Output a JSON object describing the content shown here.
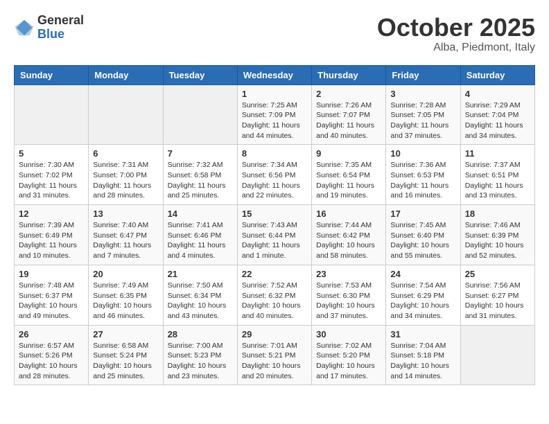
{
  "header": {
    "logo_general": "General",
    "logo_blue": "Blue",
    "month_title": "October 2025",
    "location": "Alba, Piedmont, Italy"
  },
  "days_of_week": [
    "Sunday",
    "Monday",
    "Tuesday",
    "Wednesday",
    "Thursday",
    "Friday",
    "Saturday"
  ],
  "weeks": [
    [
      {
        "day": "",
        "info": ""
      },
      {
        "day": "",
        "info": ""
      },
      {
        "day": "",
        "info": ""
      },
      {
        "day": "1",
        "info": "Sunrise: 7:25 AM\nSunset: 7:09 PM\nDaylight: 11 hours\nand 44 minutes."
      },
      {
        "day": "2",
        "info": "Sunrise: 7:26 AM\nSunset: 7:07 PM\nDaylight: 11 hours\nand 40 minutes."
      },
      {
        "day": "3",
        "info": "Sunrise: 7:28 AM\nSunset: 7:05 PM\nDaylight: 11 hours\nand 37 minutes."
      },
      {
        "day": "4",
        "info": "Sunrise: 7:29 AM\nSunset: 7:04 PM\nDaylight: 11 hours\nand 34 minutes."
      }
    ],
    [
      {
        "day": "5",
        "info": "Sunrise: 7:30 AM\nSunset: 7:02 PM\nDaylight: 11 hours\nand 31 minutes."
      },
      {
        "day": "6",
        "info": "Sunrise: 7:31 AM\nSunset: 7:00 PM\nDaylight: 11 hours\nand 28 minutes."
      },
      {
        "day": "7",
        "info": "Sunrise: 7:32 AM\nSunset: 6:58 PM\nDaylight: 11 hours\nand 25 minutes."
      },
      {
        "day": "8",
        "info": "Sunrise: 7:34 AM\nSunset: 6:56 PM\nDaylight: 11 hours\nand 22 minutes."
      },
      {
        "day": "9",
        "info": "Sunrise: 7:35 AM\nSunset: 6:54 PM\nDaylight: 11 hours\nand 19 minutes."
      },
      {
        "day": "10",
        "info": "Sunrise: 7:36 AM\nSunset: 6:53 PM\nDaylight: 11 hours\nand 16 minutes."
      },
      {
        "day": "11",
        "info": "Sunrise: 7:37 AM\nSunset: 6:51 PM\nDaylight: 11 hours\nand 13 minutes."
      }
    ],
    [
      {
        "day": "12",
        "info": "Sunrise: 7:39 AM\nSunset: 6:49 PM\nDaylight: 11 hours\nand 10 minutes."
      },
      {
        "day": "13",
        "info": "Sunrise: 7:40 AM\nSunset: 6:47 PM\nDaylight: 11 hours\nand 7 minutes."
      },
      {
        "day": "14",
        "info": "Sunrise: 7:41 AM\nSunset: 6:46 PM\nDaylight: 11 hours\nand 4 minutes."
      },
      {
        "day": "15",
        "info": "Sunrise: 7:43 AM\nSunset: 6:44 PM\nDaylight: 11 hours\nand 1 minute."
      },
      {
        "day": "16",
        "info": "Sunrise: 7:44 AM\nSunset: 6:42 PM\nDaylight: 10 hours\nand 58 minutes."
      },
      {
        "day": "17",
        "info": "Sunrise: 7:45 AM\nSunset: 6:40 PM\nDaylight: 10 hours\nand 55 minutes."
      },
      {
        "day": "18",
        "info": "Sunrise: 7:46 AM\nSunset: 6:39 PM\nDaylight: 10 hours\nand 52 minutes."
      }
    ],
    [
      {
        "day": "19",
        "info": "Sunrise: 7:48 AM\nSunset: 6:37 PM\nDaylight: 10 hours\nand 49 minutes."
      },
      {
        "day": "20",
        "info": "Sunrise: 7:49 AM\nSunset: 6:35 PM\nDaylight: 10 hours\nand 46 minutes."
      },
      {
        "day": "21",
        "info": "Sunrise: 7:50 AM\nSunset: 6:34 PM\nDaylight: 10 hours\nand 43 minutes."
      },
      {
        "day": "22",
        "info": "Sunrise: 7:52 AM\nSunset: 6:32 PM\nDaylight: 10 hours\nand 40 minutes."
      },
      {
        "day": "23",
        "info": "Sunrise: 7:53 AM\nSunset: 6:30 PM\nDaylight: 10 hours\nand 37 minutes."
      },
      {
        "day": "24",
        "info": "Sunrise: 7:54 AM\nSunset: 6:29 PM\nDaylight: 10 hours\nand 34 minutes."
      },
      {
        "day": "25",
        "info": "Sunrise: 7:56 AM\nSunset: 6:27 PM\nDaylight: 10 hours\nand 31 minutes."
      }
    ],
    [
      {
        "day": "26",
        "info": "Sunrise: 6:57 AM\nSunset: 5:26 PM\nDaylight: 10 hours\nand 28 minutes."
      },
      {
        "day": "27",
        "info": "Sunrise: 6:58 AM\nSunset: 5:24 PM\nDaylight: 10 hours\nand 25 minutes."
      },
      {
        "day": "28",
        "info": "Sunrise: 7:00 AM\nSunset: 5:23 PM\nDaylight: 10 hours\nand 23 minutes."
      },
      {
        "day": "29",
        "info": "Sunrise: 7:01 AM\nSunset: 5:21 PM\nDaylight: 10 hours\nand 20 minutes."
      },
      {
        "day": "30",
        "info": "Sunrise: 7:02 AM\nSunset: 5:20 PM\nDaylight: 10 hours\nand 17 minutes."
      },
      {
        "day": "31",
        "info": "Sunrise: 7:04 AM\nSunset: 5:18 PM\nDaylight: 10 hours\nand 14 minutes."
      },
      {
        "day": "",
        "info": ""
      }
    ]
  ]
}
